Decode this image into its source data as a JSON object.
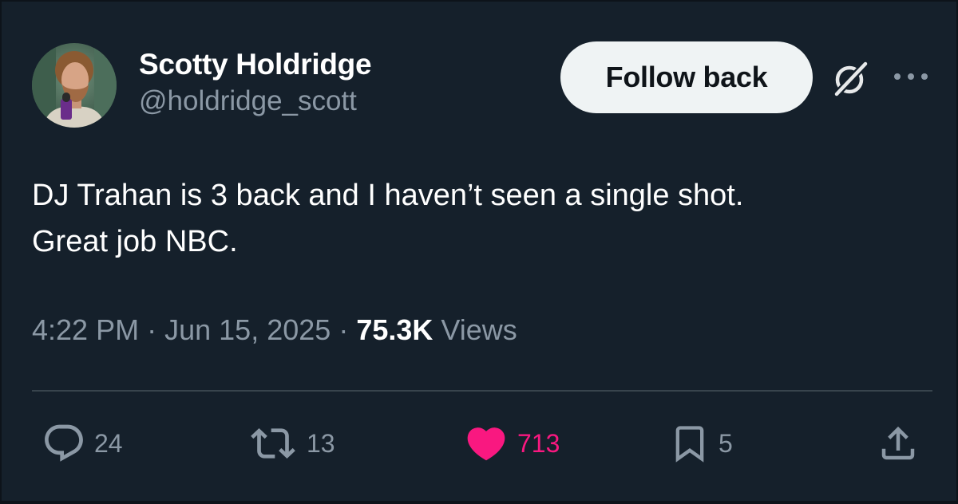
{
  "author": {
    "display_name": "Scotty Holdridge",
    "handle": "@holdridge_scott"
  },
  "header": {
    "follow_button_label": "Follow back",
    "icons": [
      "avatar",
      "grok-icon",
      "more-icon"
    ]
  },
  "tweet": {
    "text_lines": [
      "DJ Trahan is 3 back and I haven’t seen a single shot.",
      "Great job NBC."
    ]
  },
  "meta": {
    "time": "4:22 PM",
    "separator": "·",
    "date": "Jun 15, 2025",
    "views_count": "75.3K",
    "views_label": "Views"
  },
  "actions": {
    "reply_count": "24",
    "retweet_count": "13",
    "like_count": "713",
    "bookmark_count": "5",
    "icons": [
      "reply-icon",
      "retweet-icon",
      "heart-icon",
      "bookmark-icon",
      "share-icon"
    ]
  },
  "colors": {
    "background": "#15202b",
    "text_primary": "#ffffff",
    "text_secondary": "#8b98a5",
    "divider": "#38444d",
    "like_active": "#f91880",
    "button_bg": "#eff3f4"
  }
}
